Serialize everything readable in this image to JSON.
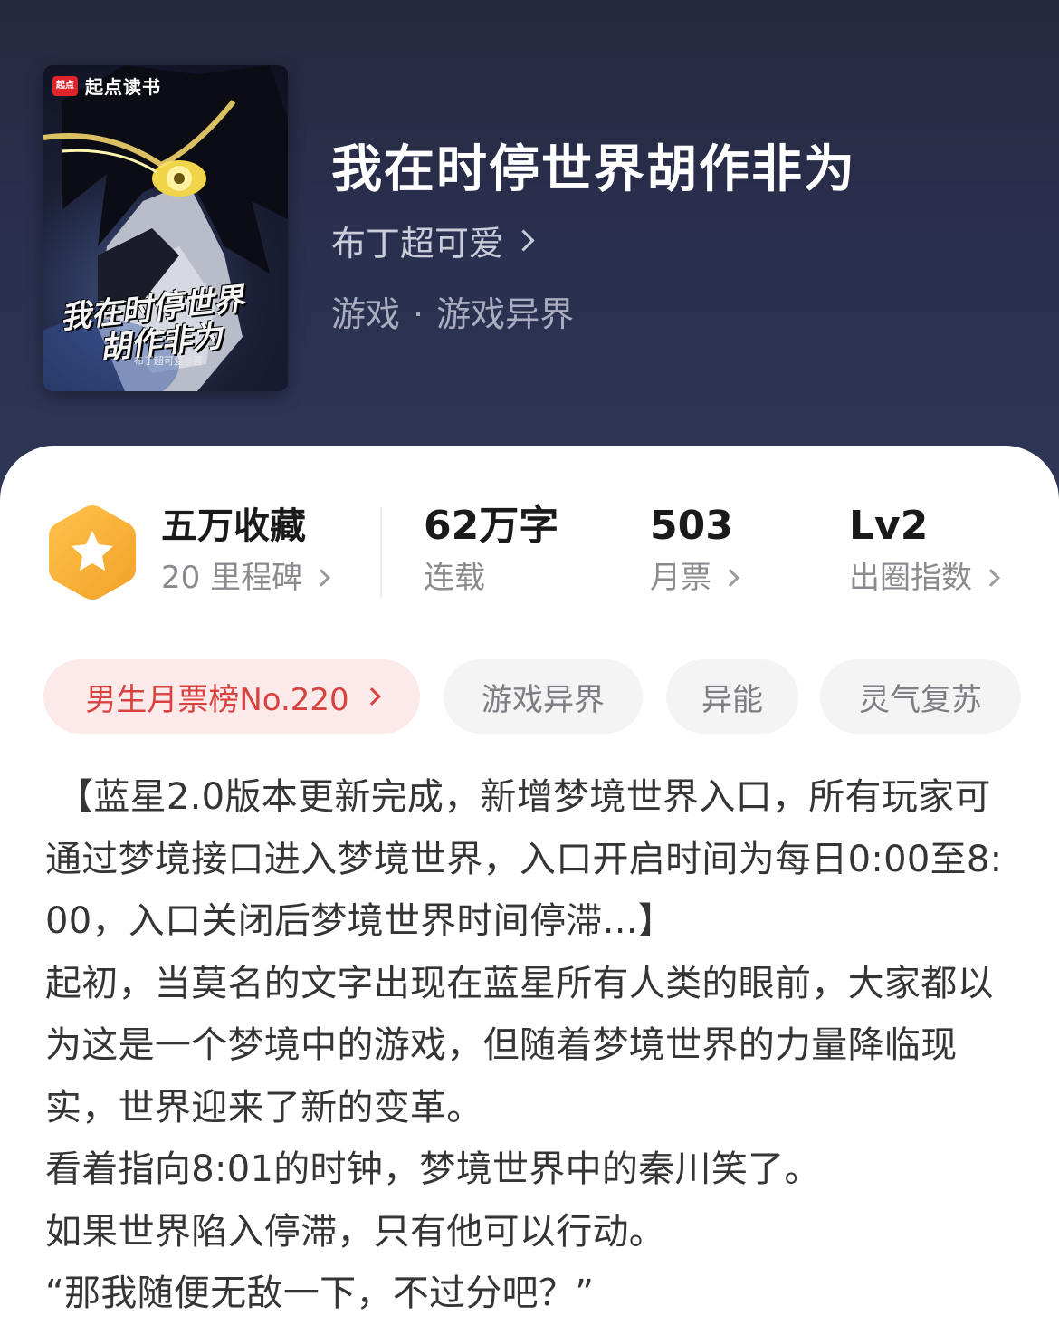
{
  "colors": {
    "header_bg": "#2a3050",
    "rank_tag_bg": "#fce9ea",
    "rank_tag_text": "#d8423f",
    "badge": "#f5b43c"
  },
  "cover": {
    "brand_logo": "起点",
    "brand_name": "起点读书",
    "title_line1": "我在时停世界",
    "title_line2": "胡作非为",
    "author": "布丁超可爱◎著"
  },
  "book": {
    "title": "我在时停世界胡作非为",
    "author": "布丁超可爱",
    "genre": "游戏",
    "separator": "·",
    "subgenre": "游戏异界"
  },
  "stats": {
    "badge_icon": "star-icon",
    "collect": {
      "value": "五万收藏",
      "label": "20 里程碑"
    },
    "words": {
      "value": "62万字",
      "label": "连载"
    },
    "tickets": {
      "value": "503",
      "label": "月票"
    },
    "influence": {
      "value": "Lv2",
      "label": "出圈指数"
    }
  },
  "tags": [
    {
      "label": "男生月票榜No.220"
    },
    {
      "label": "游戏异界"
    },
    {
      "label": "异能"
    },
    {
      "label": "灵气复苏"
    }
  ],
  "synopsis": [
    " 【蓝星2.0版本更新完成，新增梦境世界入口，所有玩家可通过梦境接口进入梦境世界，入口开启时间为每日0:00至8:00，入口关闭后梦境世界时间停滞...】",
    "起初，当莫名的文字出现在蓝星所有人类的眼前，大家都以为这是一个梦境中的游戏，但随着梦境世界的力量降临现实，世界迎来了新的变革。",
    "看着指向8:01的时钟，梦境世界中的秦川笑了。",
    "如果世界陷入停滞，只有他可以行动。",
    "“那我随便无敌一下，不过分吧？”"
  ]
}
